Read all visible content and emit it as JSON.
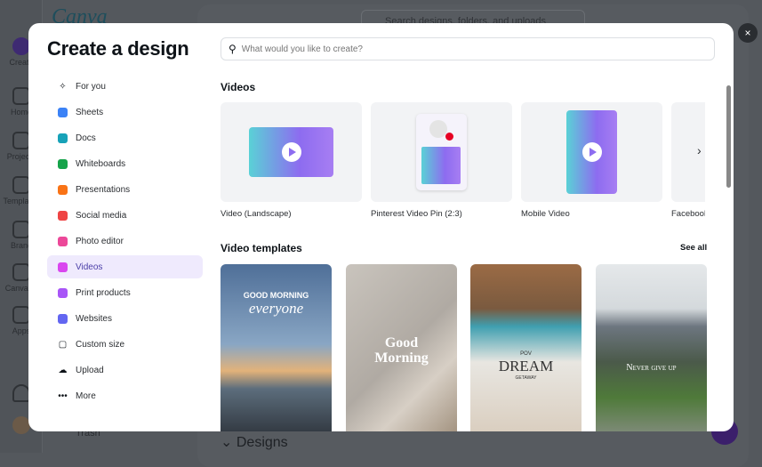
{
  "background": {
    "logo": "Canva",
    "search_placeholder": "Search designs, folders, and uploads",
    "rail": [
      "Create",
      "Home",
      "Projects",
      "Templates",
      "Brand",
      "Canva AI",
      "Apps"
    ],
    "trash": "Trash",
    "designs": "Designs"
  },
  "modal": {
    "title": "Create a design",
    "close": "×",
    "search_placeholder": "What would you like to create?",
    "nav": [
      {
        "label": "For you",
        "icon": "sparkle-icon",
        "color": "#0e1318"
      },
      {
        "label": "Sheets",
        "icon": "sheets-icon",
        "color": "#3b82f6"
      },
      {
        "label": "Docs",
        "icon": "docs-icon",
        "color": "#17a2b8"
      },
      {
        "label": "Whiteboards",
        "icon": "whiteboard-icon",
        "color": "#16a34a"
      },
      {
        "label": "Presentations",
        "icon": "presentation-icon",
        "color": "#f97316"
      },
      {
        "label": "Social media",
        "icon": "heart-icon",
        "color": "#ef4444"
      },
      {
        "label": "Photo editor",
        "icon": "camera-icon",
        "color": "#ec4899"
      },
      {
        "label": "Videos",
        "icon": "video-icon",
        "color": "#d946ef"
      },
      {
        "label": "Print products",
        "icon": "printer-icon",
        "color": "#a855f7"
      },
      {
        "label": "Websites",
        "icon": "website-icon",
        "color": "#6366f1"
      },
      {
        "label": "Custom size",
        "icon": "resize-icon",
        "color": "#0e1318"
      },
      {
        "label": "Upload",
        "icon": "upload-icon",
        "color": "#0e1318"
      },
      {
        "label": "More",
        "icon": "more-icon",
        "color": "#0e1318"
      }
    ],
    "active_nav": "Videos",
    "videos_heading": "Videos",
    "videos": [
      "Video (Landscape)",
      "Pinterest Video Pin (2:3)",
      "Mobile Video",
      "Facebook Video"
    ],
    "templates_heading": "Video templates",
    "see_all": "See all",
    "templates": [
      {
        "line1": "GOOD MORNING",
        "line2": "everyone"
      },
      {
        "line1": "Good",
        "line2": "Morning"
      },
      {
        "line0": "POV",
        "line1": "DREAM",
        "line2": "GETAWAY"
      },
      {
        "line1": "Never give up"
      }
    ]
  }
}
